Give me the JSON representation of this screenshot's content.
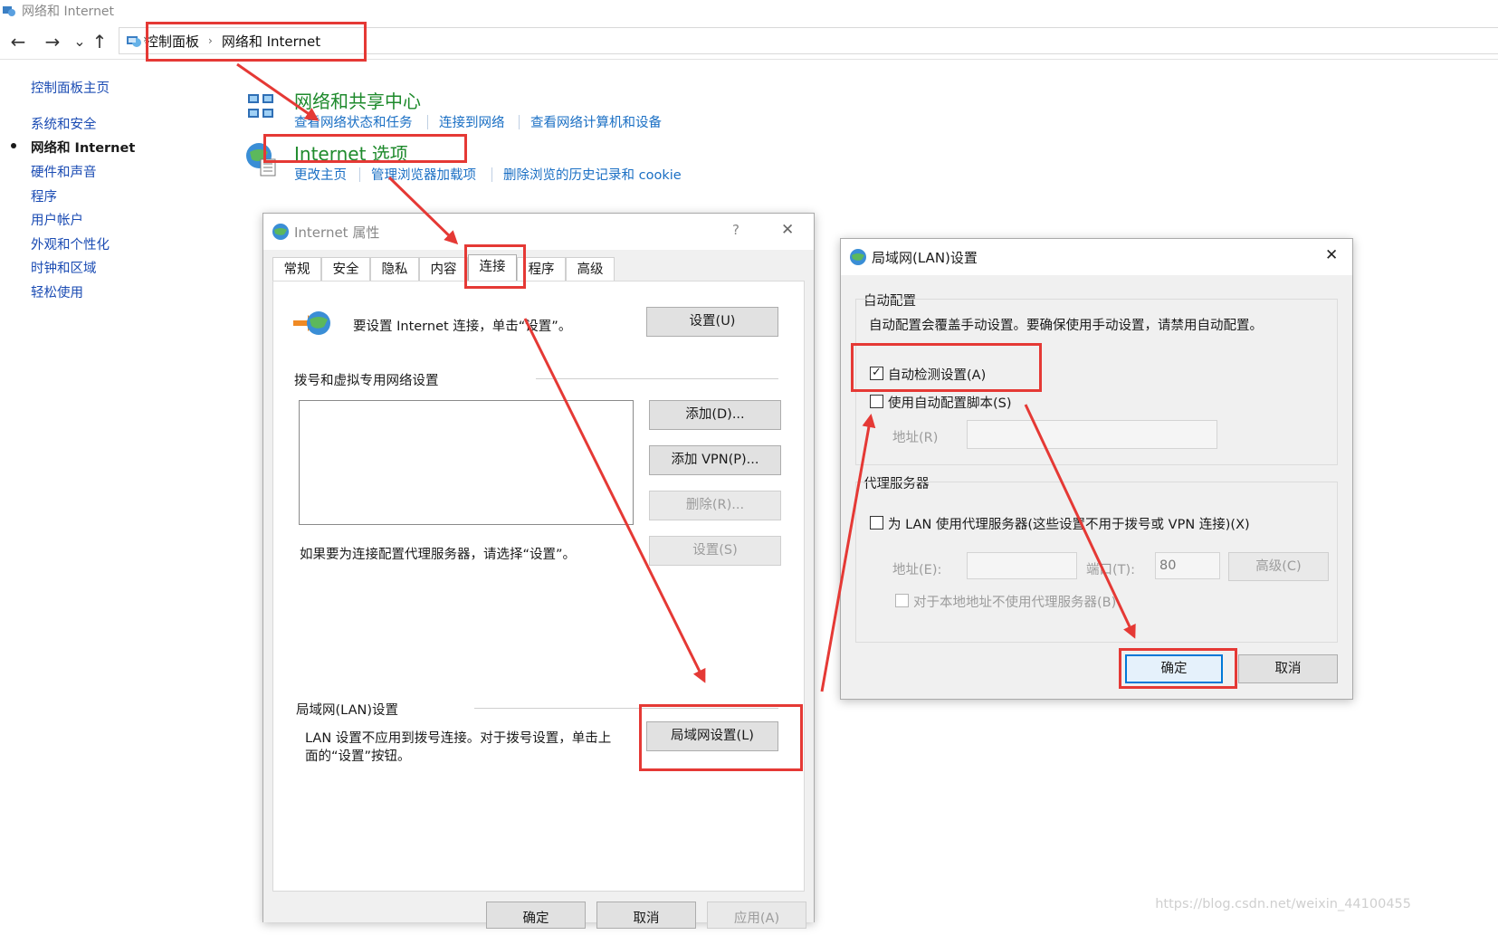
{
  "window": {
    "title": "网络和 Internet"
  },
  "nav": {
    "back_icon": "←",
    "forward_icon": "→",
    "recent_icon": "⌄",
    "up_icon": "↑",
    "breadcrumb": [
      "控制面板",
      "网络和 Internet"
    ],
    "separator": "›"
  },
  "sidebar": {
    "home": "控制面板主页",
    "items": [
      {
        "label": "系统和安全",
        "active": false
      },
      {
        "label": "网络和 Internet",
        "active": true
      },
      {
        "label": "硬件和声音",
        "active": false
      },
      {
        "label": "程序",
        "active": false
      },
      {
        "label": "用户帐户",
        "active": false
      },
      {
        "label": "外观和个性化",
        "active": false
      },
      {
        "label": "时钟和区域",
        "active": false
      },
      {
        "label": "轻松使用",
        "active": false
      }
    ]
  },
  "categories": [
    {
      "title": "网络和共享中心",
      "icon": "network-sharing-icon",
      "links": [
        "查看网络状态和任务",
        "连接到网络",
        "查看网络计算机和设备"
      ]
    },
    {
      "title": "Internet 选项",
      "icon": "internet-options-globe-icon",
      "links": [
        "更改主页",
        "管理浏览器加载项",
        "删除浏览的历史记录和 cookie"
      ]
    }
  ],
  "internet_props": {
    "title": "Internet 属性",
    "help": "?",
    "close": "✕",
    "tabs": [
      "常规",
      "安全",
      "隐私",
      "内容",
      "连接",
      "程序",
      "高级"
    ],
    "selected_tab": "连接",
    "setup_text": "要设置 Internet 连接，单击“设置”。",
    "setup_button": "设置(U)",
    "dialup_heading": "拨号和虚拟专用网络设置",
    "add_button": "添加(D)...",
    "add_vpn_button": "添加 VPN(P)...",
    "remove_button": "删除(R)...",
    "settings_button": "设置(S)",
    "proxy_hint": "如果要为连接配置代理服务器，请选择“设置”。",
    "lan_heading": "局域网(LAN)设置",
    "lan_text_line1": "LAN 设置不应用到拨号连接。对于拨号设置，单击上",
    "lan_text_line2": "面的“设置”按钮。",
    "lan_button": "局域网设置(L)",
    "ok_button": "确定",
    "cancel_button": "取消",
    "apply_button": "应用(A)"
  },
  "lan_dialog": {
    "title": "局域网(LAN)设置",
    "close": "✕",
    "auto_group": "自动配置",
    "auto_desc": "自动配置会覆盖手动设置。要确保使用手动设置，请禁用自动配置。",
    "auto_detect": {
      "label": "自动检测设置(A)",
      "checked": true,
      "mark": "✓"
    },
    "auto_script": {
      "label": "使用自动配置脚本(S)",
      "checked": false
    },
    "address_label": "地址(R)",
    "proxy_group": "代理服务器",
    "use_proxy": {
      "label": "为 LAN 使用代理服务器(这些设置不用于拨号或 VPN 连接)(X)",
      "checked": false
    },
    "proxy_address_label": "地址(E):",
    "port_label": "端口(T):",
    "port_value": "80",
    "advanced_button": "高级(C)",
    "bypass_local": {
      "label": "对于本地地址不使用代理服务器(B)",
      "checked": false
    },
    "ok_button": "确定",
    "cancel_button": "取消"
  },
  "watermark": "https://blog.csdn.net/weixin_44100455",
  "colors": {
    "link": "#1a6fc4",
    "category": "#1e8a2c",
    "annotation": "#e53935",
    "accent": "#0078d7"
  }
}
